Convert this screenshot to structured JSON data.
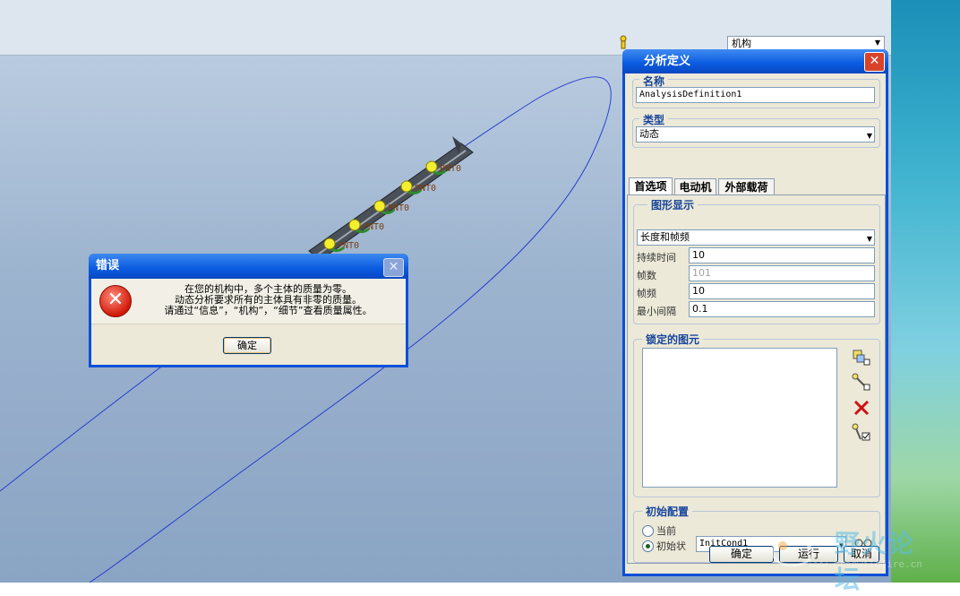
{
  "toolbar": {
    "mechanism_combo_value": "机构"
  },
  "model": {
    "point_labels": [
      "PNT0",
      "PNT0",
      "PNT0",
      "PNT0",
      "PNT0"
    ]
  },
  "error_dialog": {
    "title": "错误",
    "close_icon": "close-icon",
    "error_icon": "error-icon",
    "message_lines": [
      "在您的机构中，多个主体的质量为零。",
      "动态分析要求所有的主体具有非零的质量。",
      "请通过“信息”，“机构”，“细节”查看质量属性。"
    ],
    "ok_label": "确定"
  },
  "analysis_dialog": {
    "title": "分析定义",
    "name_group": "名称",
    "name_value": "AnalysisDefinition1",
    "type_group": "类型",
    "type_value": "动态",
    "tabs": [
      {
        "label": "首选项",
        "active": true
      },
      {
        "label": "电动机",
        "active": false
      },
      {
        "label": "外部载荷",
        "active": false
      }
    ],
    "graphics_group": "图形显示",
    "graphics_mode": "长度和帧频",
    "rows": [
      {
        "label": "持续时间",
        "value": "10",
        "disabled": false
      },
      {
        "label": "帧数",
        "value": "101",
        "disabled": true
      },
      {
        "label": "帧频",
        "value": "10",
        "disabled": false
      },
      {
        "label": "最小间隔",
        "value": "0.1",
        "disabled": false
      }
    ],
    "locked_group": "锁定的图元",
    "side_icons": [
      "lock-body-icon",
      "lock-connection-icon",
      "delete-icon",
      "enable-connection-icon"
    ],
    "init_group": "初始配置",
    "radio_current": "当前",
    "radio_initial": "初始状",
    "initial_condition": "InitCond1",
    "glasses_icon": "glasses-icon",
    "ok_label": "确定",
    "run_label": "运行",
    "cancel_label": "取消"
  },
  "watermark": {
    "text": "野火论坛",
    "url": "www.proewildfire.cn"
  }
}
